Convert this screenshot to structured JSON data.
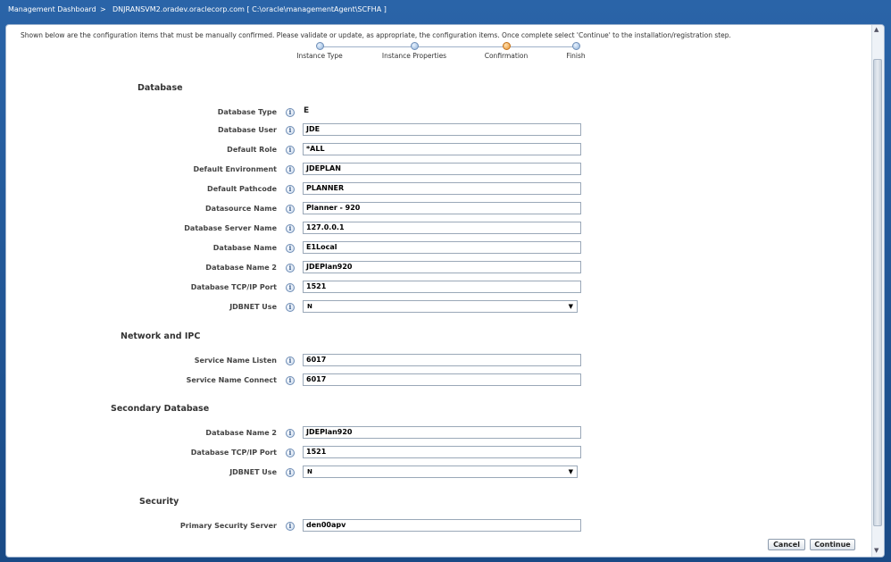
{
  "titlebar": {
    "app": "Management Dashboard",
    "separator": ">",
    "path": "DNJRANSVM2.oradev.oraclecorp.com [ C:\\oracle\\managementAgent\\SCFHA ]"
  },
  "instruction": "Shown below are the configuration items that must be manually confirmed. Please validate or update, as appropriate, the configuration items. Once complete select 'Continue' to the installation/registration step.",
  "train": {
    "steps": [
      "Instance Type",
      "Instance Properties",
      "Confirmation",
      "Finish"
    ],
    "current": "Confirmation"
  },
  "info_glyph": "i",
  "sections": {
    "database": {
      "title": "Database",
      "database_type": {
        "label": "Database Type",
        "value": "E"
      },
      "database_user": {
        "label": "Database User",
        "value": "JDE"
      },
      "default_role": {
        "label": "Default Role",
        "value": "*ALL"
      },
      "default_environment": {
        "label": "Default Environment",
        "value": "JDEPLAN"
      },
      "default_pathcode": {
        "label": "Default Pathcode",
        "value": "PLANNER"
      },
      "datasource_name": {
        "label": "Datasource Name",
        "value": "Planner - 920"
      },
      "database_server_name": {
        "label": "Database Server Name",
        "value": "127.0.0.1"
      },
      "database_name": {
        "label": "Database Name",
        "value": "E1Local"
      },
      "database_name_2": {
        "label": "Database Name 2",
        "value": "JDEPlan920"
      },
      "tcp_port": {
        "label": "Database TCP/IP Port",
        "value": "1521"
      },
      "jdbnet_use": {
        "label": "JDBNET Use",
        "value": "N"
      }
    },
    "network": {
      "title": "Network and IPC",
      "service_name_listen": {
        "label": "Service Name Listen",
        "value": "6017"
      },
      "service_name_connect": {
        "label": "Service Name Connect",
        "value": "6017"
      }
    },
    "secondary": {
      "title": "Secondary Database",
      "database_name_2": {
        "label": "Database Name 2",
        "value": "JDEPlan920"
      },
      "tcp_port": {
        "label": "Database TCP/IP Port",
        "value": "1521"
      },
      "jdbnet_use": {
        "label": "JDBNET Use",
        "value": "N"
      }
    },
    "security": {
      "title": "Security",
      "primary_server": {
        "label": "Primary Security Server",
        "value": "den00apv"
      }
    }
  },
  "buttons": {
    "cancel": "Cancel",
    "continue": "Continue"
  },
  "colors": {
    "accent": "#1b4f8c",
    "current_step": "#e8912f"
  }
}
